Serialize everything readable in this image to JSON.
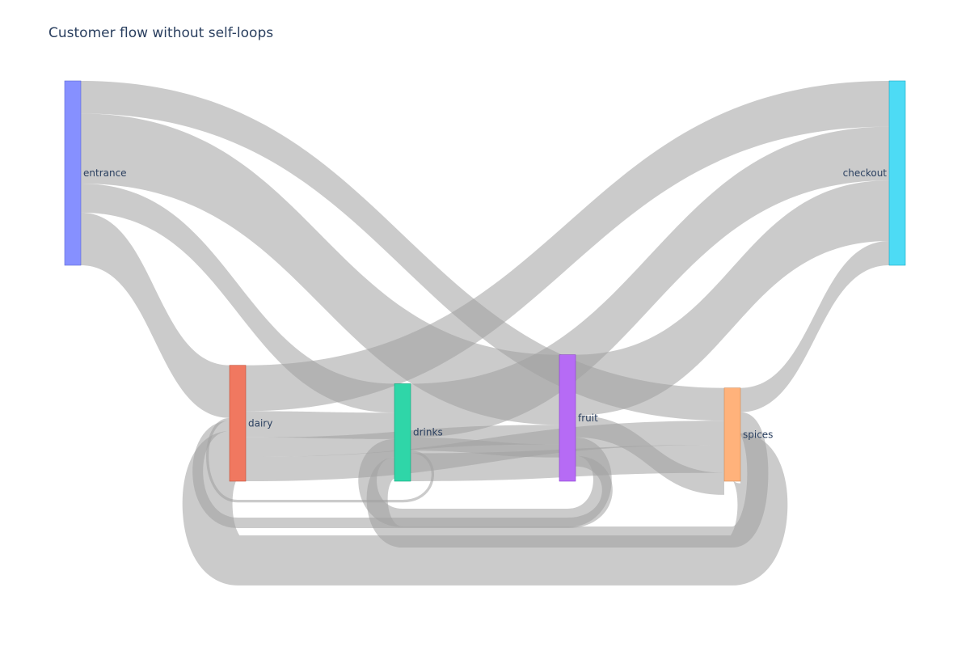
{
  "chart_data": {
    "type": "sankey",
    "title": "Customer flow without self-loops",
    "nodes": [
      {
        "id": "entrance",
        "label": "entrance",
        "color": "#8690ff",
        "stroke": "#5e6ad2",
        "total": 350
      },
      {
        "id": "checkout",
        "label": "checkout",
        "color": "#4ddbf5",
        "stroke": "#1ca8c3",
        "total": 350
      },
      {
        "id": "dairy",
        "label": "dairy",
        "color": "#f07860",
        "stroke": "#c0503a",
        "total": 220
      },
      {
        "id": "drinks",
        "label": "drinks",
        "color": "#2fd6a8",
        "stroke": "#14a37c",
        "total": 185
      },
      {
        "id": "fruit",
        "label": "fruit",
        "color": "#b66bf5",
        "stroke": "#8a3fd0",
        "total": 240
      },
      {
        "id": "spices",
        "label": "spices",
        "color": "#ffb27b",
        "stroke": "#d08a55",
        "total": 177
      }
    ],
    "links": [
      {
        "source": "entrance",
        "target": "spices",
        "value": 62
      },
      {
        "source": "entrance",
        "target": "fruit",
        "value": 133
      },
      {
        "source": "entrance",
        "target": "drinks",
        "value": 55
      },
      {
        "source": "entrance",
        "target": "dairy",
        "value": 100
      },
      {
        "source": "dairy",
        "target": "checkout",
        "value": 87
      },
      {
        "source": "dairy",
        "target": "drinks",
        "value": 50
      },
      {
        "source": "dairy",
        "target": "fruit",
        "value": 37
      },
      {
        "source": "dairy",
        "target": "spices",
        "value": 46
      },
      {
        "source": "drinks",
        "target": "checkout",
        "value": 102
      },
      {
        "source": "drinks",
        "target": "fruit",
        "value": 25
      },
      {
        "source": "drinks",
        "target": "dairy",
        "value": 5
      },
      {
        "source": "drinks",
        "target": "spices",
        "value": 53
      },
      {
        "source": "fruit",
        "target": "checkout",
        "value": 115
      },
      {
        "source": "fruit",
        "target": "spices",
        "value": 42
      },
      {
        "source": "fruit",
        "target": "drinks",
        "value": 35
      },
      {
        "source": "fruit",
        "target": "dairy",
        "value": 20
      },
      {
        "source": "spices",
        "target": "checkout",
        "value": 46
      },
      {
        "source": "spices",
        "target": "drinks",
        "value": 40
      },
      {
        "source": "spices",
        "target": "dairy",
        "value": 95
      }
    ],
    "link_color": "rgba(160,160,160,0.55)"
  }
}
